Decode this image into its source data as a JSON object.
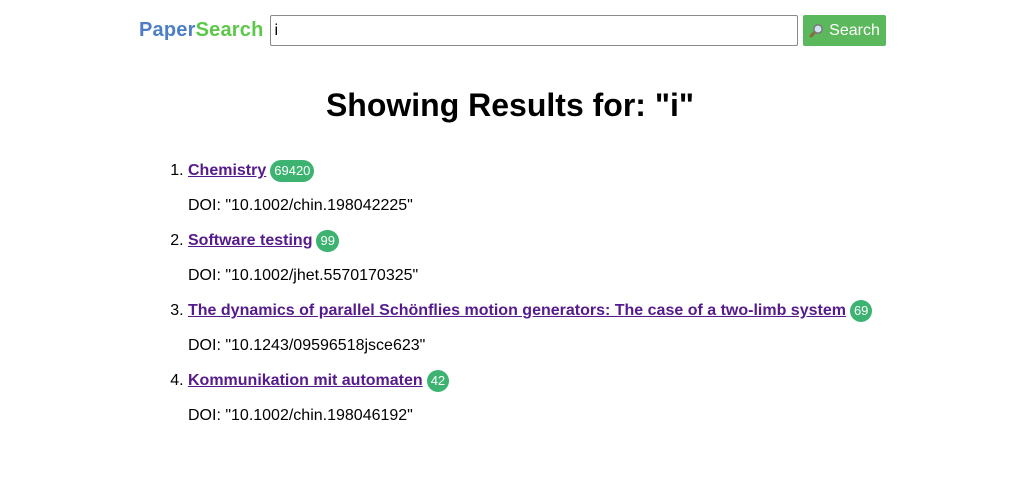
{
  "logo": {
    "part1": "Paper",
    "part2": "Search"
  },
  "search": {
    "value": "i",
    "button_label": "Search"
  },
  "heading": "Showing Results for: \"i\"",
  "results": [
    {
      "title": "Chemistry",
      "count": "69420",
      "doi": "DOI: \"10.1002/chin.198042225\""
    },
    {
      "title": "Software testing",
      "count": "99",
      "doi": "DOI: \"10.1002/jhet.5570170325\""
    },
    {
      "title": "The dynamics of parallel Schönflies motion generators: The case of a two-limb system",
      "count": "69",
      "doi": "DOI: \"10.1243/09596518jsce623\""
    },
    {
      "title": "Kommunikation mit automaten",
      "count": "42",
      "doi": "DOI: \"10.1002/chin.198046192\""
    }
  ],
  "colors": {
    "logo_blue": "#4f7ec8",
    "logo_green": "#5cc84a",
    "button": "#5cb85c",
    "badge": "#3cb371",
    "link": "#551a8b"
  },
  "icons": {
    "search_button": "magnifying-glass-icon"
  }
}
